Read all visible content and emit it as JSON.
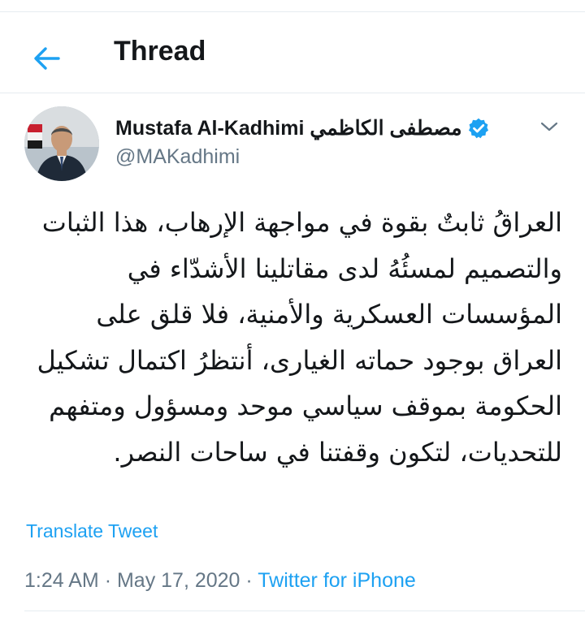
{
  "header": {
    "title": "Thread",
    "back_icon": "arrow-left-icon"
  },
  "colors": {
    "accent": "#1da1f2",
    "text_primary": "#14171a",
    "text_secondary": "#657786",
    "divider": "#e6ecf0"
  },
  "tweet": {
    "author": {
      "display_name": "Mustafa Al-Kadhimi مصطفى الكاظمي",
      "handle": "@MAKadhimi",
      "verified": true
    },
    "more_icon": "chevron-down-icon",
    "text": "العراقُ ثابتٌ بقوة في مواجهة الإرهاب، هذا الثبات والتصميم لمسئُهُ لدى مقاتلينا الأشدّاء في المؤسسات العسكرية والأمنية، فلا قلق على العراق بوجود حماته الغيارى، أنتظرُ اكتمال تشكيل الحكومة بموقف سياسي موحد ومسؤول ومتفهم للتحديات، لتكون وقفتنا في ساحات النصر.",
    "translate_label": "Translate Tweet",
    "time": "1:24 AM",
    "separator": "·",
    "date": "May 17, 2020",
    "source": "Twitter for iPhone"
  }
}
